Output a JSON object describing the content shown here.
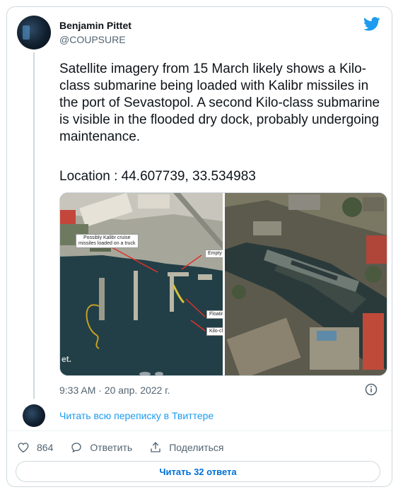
{
  "author": {
    "name": "Benjamin Pittet",
    "handle": "@COUPSURE"
  },
  "tweet": {
    "text": "Satellite imagery from 15 March likely shows a Kilo-class submarine being loaded with Kalibr missiles in the port of Sevastopol. A second Kilo-class submarine is visible in the flooded dry dock, probably undergoing maintenance.",
    "location": "Location : 44.607739, 33.534983"
  },
  "media": {
    "left_annotations": {
      "cruise": "Possibly Kalibr cruise\nmissiles loaded on a truck",
      "empty": "Empty T",
      "floating": "Floatin",
      "kilo": "Kilo-clas"
    },
    "watermark": "et."
  },
  "timestamp": "9:33 AM · 20 апр. 2022 г.",
  "read_thread": "Читать всю переписку в Твиттере",
  "actions": {
    "likes": "864",
    "reply": "Ответить",
    "share": "Поделиться"
  },
  "replies_button": "Читать 32 ответа",
  "colors": {
    "accent": "#1d9bf0",
    "text": "#0f1419",
    "secondary": "#536471",
    "border": "#cfd9de"
  },
  "icons": [
    "twitter-bird-icon",
    "info-icon",
    "heart-icon",
    "reply-icon",
    "share-icon"
  ]
}
